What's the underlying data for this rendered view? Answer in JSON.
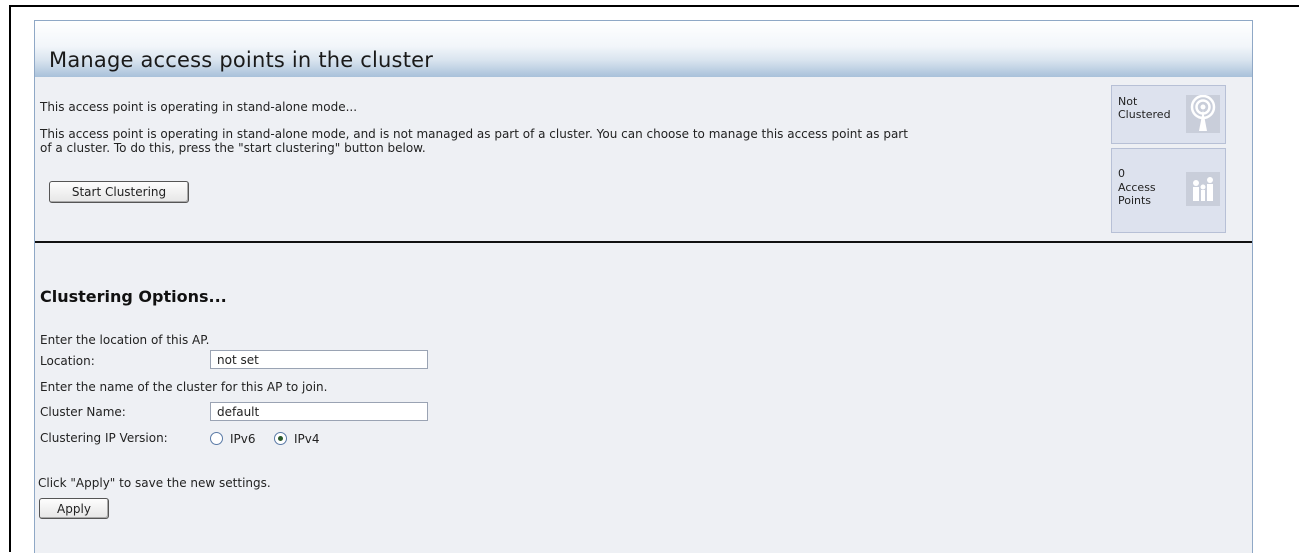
{
  "header": {
    "title": "Manage access points in the cluster"
  },
  "status": {
    "line1": "This access point is operating in stand-alone mode...",
    "line2": "This access point is operating in stand-alone mode, and is not managed as part of a cluster. You can choose to manage this access point as part",
    "line3": "of a cluster. To do this, press the \"start clustering\" button below.",
    "start_button_label": "Start Clustering"
  },
  "side_panel": {
    "cluster_status": {
      "line1": "Not",
      "line2": "Clustered",
      "icon": "antenna-icon"
    },
    "ap_count": {
      "count": "0",
      "line2": "Access",
      "line3": "Points",
      "icon": "people-icon"
    }
  },
  "options": {
    "title": "Clustering Options...",
    "location_prompt": "Enter the location of this AP.",
    "location_label": "Location:",
    "location_value": "not set",
    "cluster_prompt": "Enter the name of the cluster for this AP to join.",
    "cluster_label": "Cluster Name:",
    "cluster_value": "default",
    "ip_version_label": "Clustering IP Version:",
    "ip_options": [
      {
        "label": "IPv6",
        "selected": false
      },
      {
        "label": "IPv4",
        "selected": true
      }
    ],
    "apply_prompt": "Click \"Apply\" to save the new settings.",
    "apply_button_label": "Apply"
  }
}
